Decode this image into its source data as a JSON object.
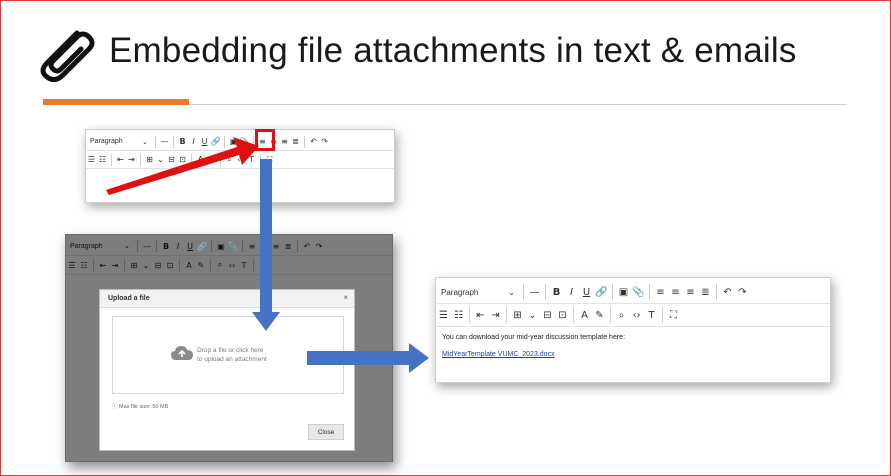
{
  "slide": {
    "title": "Embedding file attachments in text & emails",
    "icon": "paperclip-icon",
    "accent_color": "#e87b2e",
    "arrow_blue": "#4472c4",
    "arrow_red": "#e01010"
  },
  "editor_small": {
    "paragraph_label": "Paragraph",
    "bold": "B",
    "italic": "I",
    "underline": "U"
  },
  "editor_modal": {
    "paragraph_label": "Paragraph",
    "bold": "B",
    "italic": "I",
    "underline": "U",
    "modal_title": "Upload a file",
    "close_x": "×",
    "drop_line1": "Drop a file or click here",
    "drop_line2": "to upload an attachment",
    "max_size": "Max file size: 50 MB",
    "close_button": "Close"
  },
  "editor_result": {
    "paragraph_label": "Paragraph",
    "bold": "B",
    "italic": "I",
    "underline": "U",
    "body_text": "You can download your mid-year discussion template here:",
    "file_link": "MidYearTemplate VUMC_2023.docx"
  }
}
